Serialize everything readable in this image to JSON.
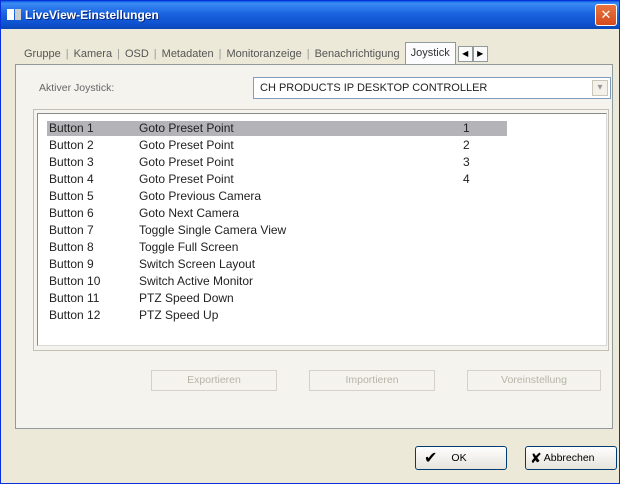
{
  "window": {
    "title": "LiveView-Einstellungen",
    "close_glyph": "✕"
  },
  "tabs": [
    {
      "label": "Gruppe",
      "active": false
    },
    {
      "label": "Kamera",
      "active": false
    },
    {
      "label": "OSD",
      "active": false
    },
    {
      "label": "Metadaten",
      "active": false
    },
    {
      "label": "Monitoranzeige",
      "active": false
    },
    {
      "label": "Benachrichtigung",
      "active": false
    },
    {
      "label": "Joystick",
      "active": true
    }
  ],
  "tab_scroll": {
    "left": "◀",
    "right": "▶"
  },
  "joystick": {
    "label": "Aktiver Joystick:",
    "selected": "CH PRODUCTS IP DESKTOP CONTROLLER"
  },
  "mappings": [
    {
      "button": "Button 1",
      "action": "Goto Preset Point",
      "param": "1",
      "selected": true
    },
    {
      "button": "Button 2",
      "action": "Goto Preset Point",
      "param": "2"
    },
    {
      "button": "Button 3",
      "action": "Goto Preset Point",
      "param": "3"
    },
    {
      "button": "Button 4",
      "action": "Goto Preset Point",
      "param": "4"
    },
    {
      "button": "Button 5",
      "action": "Goto Previous Camera",
      "param": ""
    },
    {
      "button": "Button 6",
      "action": "Goto Next Camera",
      "param": ""
    },
    {
      "button": "Button 7",
      "action": "Toggle Single Camera View",
      "param": ""
    },
    {
      "button": "Button 8",
      "action": "Toggle Full Screen",
      "param": ""
    },
    {
      "button": "Button 9",
      "action": "Switch Screen Layout",
      "param": ""
    },
    {
      "button": "Button 10",
      "action": "Switch Active Monitor",
      "param": ""
    },
    {
      "button": "Button 11",
      "action": "PTZ Speed Down",
      "param": ""
    },
    {
      "button": "Button 12",
      "action": "PTZ Speed Up",
      "param": ""
    }
  ],
  "actions": {
    "export": "Exportieren",
    "import": "Importieren",
    "default": "Voreinstellung"
  },
  "footer": {
    "ok": "OK",
    "ok_icon": "✔",
    "cancel": "Abbrechen",
    "cancel_icon": "✘"
  },
  "colors": {
    "titlebar": "#0a5ce6",
    "selection": "#b4b4b8"
  }
}
